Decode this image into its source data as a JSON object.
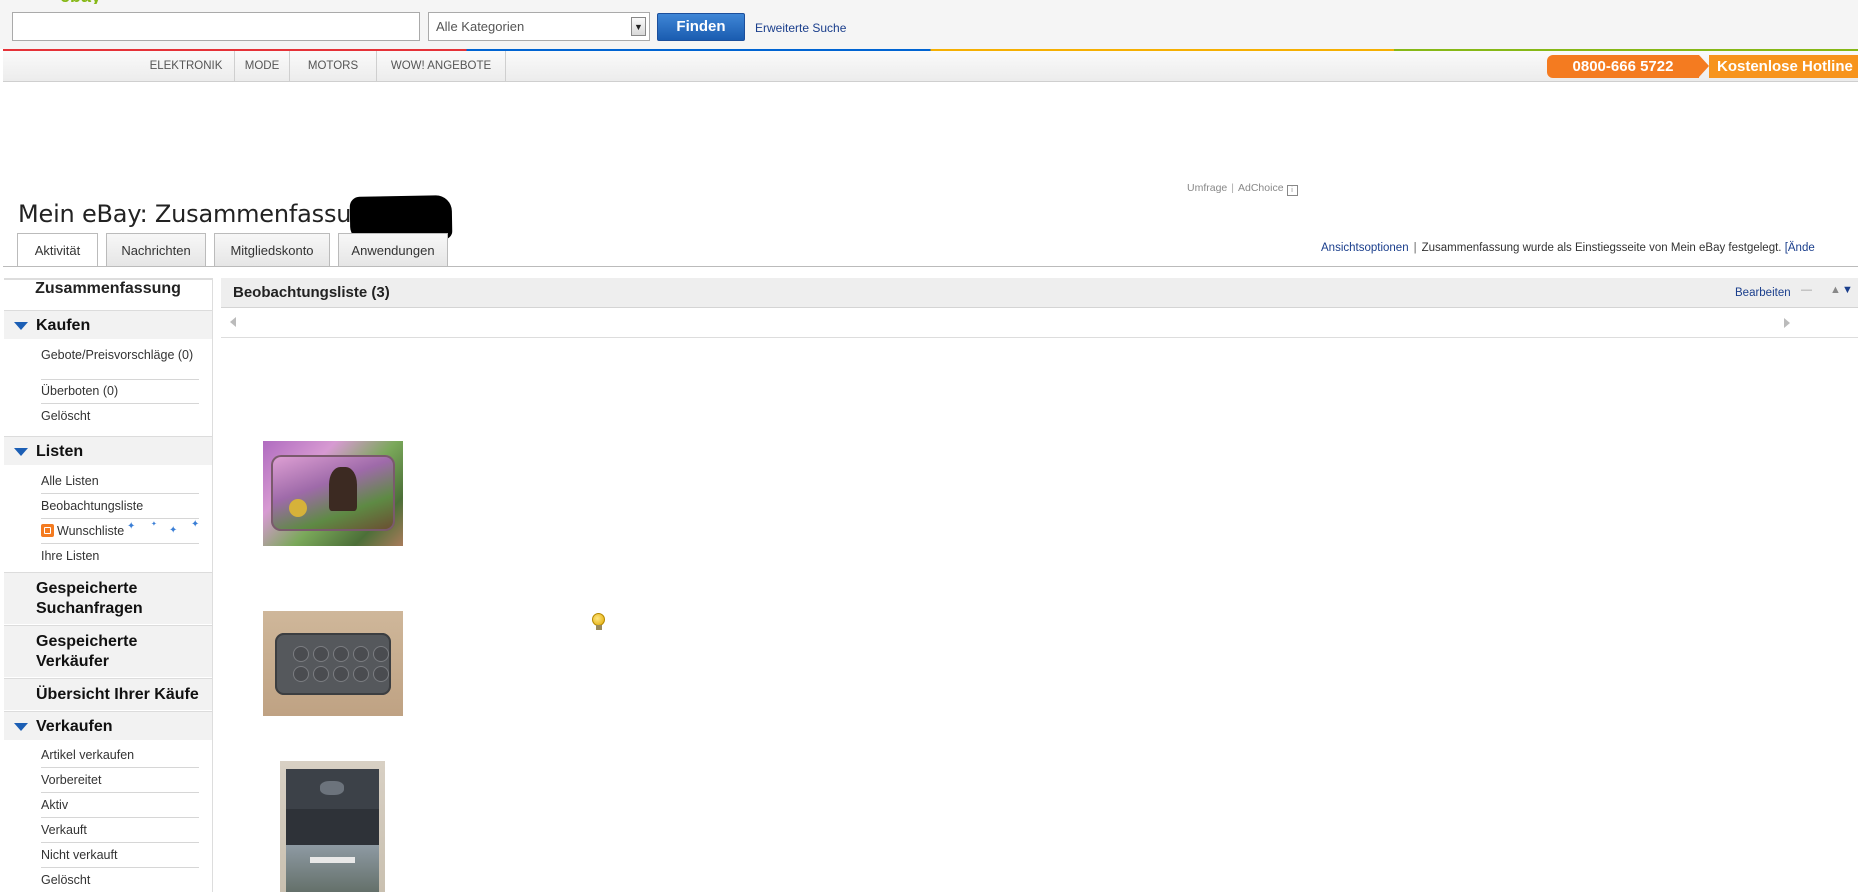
{
  "search": {
    "input_value": "",
    "category_value": "Alle Kategorien",
    "find_label": "Finden",
    "advanced_label": "Erweiterte Suche"
  },
  "nav": {
    "items": [
      "Elektronik",
      "Mode",
      "Motors",
      "WOW! Angebote"
    ]
  },
  "hotline": {
    "number": "0800-666 5722",
    "label": "Kostenlose Hotline"
  },
  "ads": {
    "survey": "Umfrage",
    "separator": "|",
    "adchoice": "AdChoice"
  },
  "page": {
    "title": "Mein eBay: Zusammenfassung"
  },
  "tabs": [
    {
      "label": "Aktivität",
      "active": true
    },
    {
      "label": "Nachrichten",
      "active": false
    },
    {
      "label": "Mitgliedskonto",
      "active": false
    },
    {
      "label": "Anwendungen",
      "active": false
    }
  ],
  "view_options": {
    "link": "Ansichtsoptionen",
    "separator": "|",
    "text": "Zusammenfassung wurde als Einstiegsseite von Mein eBay festgelegt.",
    "change": "[Ände"
  },
  "sidebar": {
    "summary": "Zusammenfassung",
    "kaufen": {
      "title": "Kaufen",
      "items": [
        "Gebote/Preisvorschläge (0)",
        "Überboten (0)",
        "Gelöscht"
      ]
    },
    "listen": {
      "title": "Listen",
      "items": [
        "Alle Listen",
        "Beobachtungsliste",
        "Wunschliste",
        "Ihre Listen"
      ]
    },
    "saved_searches": "Gespeicherte Suchanfragen",
    "saved_sellers": "Gespeicherte Verkäufer",
    "purchases": "Übersicht Ihrer Käufe",
    "verkaufen": {
      "title": "Verkaufen",
      "items": [
        "Artikel verkaufen",
        "Vorbereitet",
        "Aktiv",
        "Verkauft",
        "Nicht verkauft",
        "Gelöscht"
      ]
    }
  },
  "watchlist": {
    "title": "Beobachtungsliste (3)",
    "edit_label": "Bearbeiten"
  },
  "icons": {
    "collapse": "minus-icon",
    "move_up": "arrow-up-icon",
    "move_down": "arrow-down-icon",
    "tip": "lightbulb-icon",
    "wishlist": "wishlist-icon"
  },
  "colors": {
    "accent_blue": "#1c5fb5",
    "link_blue": "#1a3e8c",
    "hotline_orange": "#f47b20"
  }
}
